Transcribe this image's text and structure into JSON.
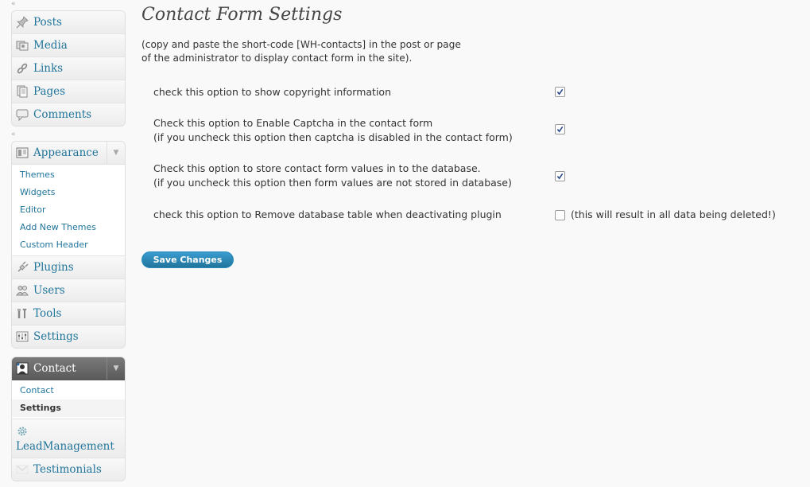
{
  "sidebar": {
    "collapse_glyph": "«",
    "group1": [
      {
        "label": "Posts",
        "icon": "pushpin-icon"
      },
      {
        "label": "Media",
        "icon": "media-icon"
      },
      {
        "label": "Links",
        "icon": "links-icon"
      },
      {
        "label": "Pages",
        "icon": "pages-icon"
      },
      {
        "label": "Comments",
        "icon": "comments-icon"
      }
    ],
    "appearance": {
      "label": "Appearance",
      "dropdown_glyph": "▼",
      "submenu": [
        "Themes",
        "Widgets",
        "Editor",
        "Add New Themes",
        "Custom Header"
      ]
    },
    "group2": [
      {
        "label": "Plugins",
        "icon": "plugins-icon"
      },
      {
        "label": "Users",
        "icon": "users-icon"
      },
      {
        "label": "Tools",
        "icon": "tools-icon"
      },
      {
        "label": "Settings",
        "icon": "settings-icon"
      }
    ],
    "contact": {
      "label": "Contact",
      "dropdown_glyph": "▼",
      "submenu": [
        {
          "label": "Contact",
          "current": false
        },
        {
          "label": "Settings",
          "current": true
        }
      ]
    },
    "leadmanagement": {
      "label": "LeadManagement",
      "icon": "gear-icon"
    },
    "testimonials": {
      "label": "Testimonials",
      "icon": "testimonials-icon"
    }
  },
  "main": {
    "title": "Contact Form Settings",
    "intro_line1": "(copy and paste the short-code [WH-contacts] in the post or page",
    "intro_line2": "of the administrator to display contact form in the site).",
    "options": [
      {
        "line1": "check this option to show copyright information",
        "line2": "",
        "checked": true,
        "note": ""
      },
      {
        "line1": "Check this option to Enable Captcha in the contact form",
        "line2": "(if you uncheck this option then captcha is disabled in the contact form)",
        "checked": true,
        "note": ""
      },
      {
        "line1": "Check this option to store contact form values in to the database.",
        "line2": "(if you uncheck this option then form values are not stored in database)",
        "checked": true,
        "note": ""
      },
      {
        "line1": "check this option to Remove database table when deactivating plugin",
        "line2": "",
        "checked": false,
        "note": "(this will result in all data being deleted!)"
      }
    ],
    "save_label": "Save Changes"
  },
  "colors": {
    "link": "#21759b",
    "button": "#21759b",
    "background": "#f9f9f9"
  }
}
